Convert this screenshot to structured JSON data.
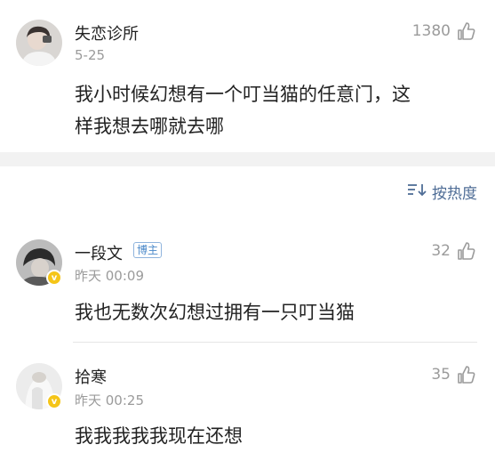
{
  "top_comment": {
    "user": "失恋诊所",
    "date": "5-25",
    "likes": "1380",
    "text_line1": "我小时候幻想有一个叮当猫的任意门，这",
    "text_line2": "样我想去哪就去哪"
  },
  "sort": {
    "label": "按热度",
    "icon": "sort-icon"
  },
  "replies": [
    {
      "user": "一段文",
      "tag": "博主",
      "time": "昨天 00:09",
      "likes": "32",
      "text": "我也无数次幻想过拥有一只叮当猫"
    },
    {
      "user": "拾寒",
      "time": "昨天 00:25",
      "likes": "35",
      "text": "我我我我我现在还想"
    }
  ],
  "colors": {
    "accent": "#4f6d96",
    "muted": "#9b9b9b",
    "badge": "#f5c518"
  }
}
